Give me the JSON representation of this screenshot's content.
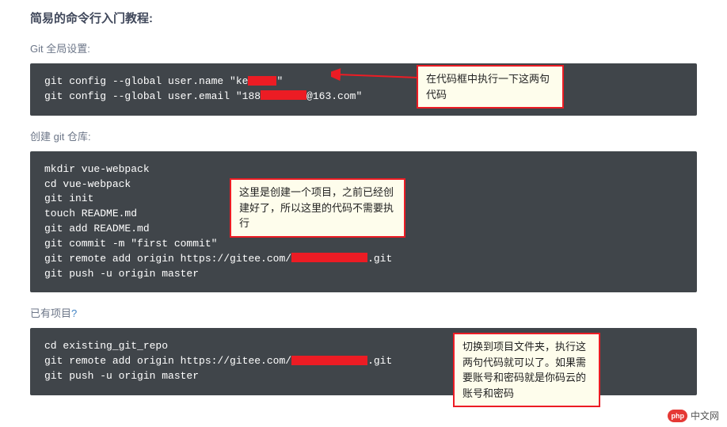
{
  "title": "简易的命令行入门教程:",
  "section1": {
    "label": "Git 全局设置:",
    "line1_a": "git config --global user.name \"ke",
    "line1_b": "\"",
    "line2_a": "git config --global user.email \"188",
    "line2_b": "@163.com\""
  },
  "section2": {
    "label": "创建 git 仓库:",
    "l1": "mkdir vue-webpack",
    "l2": "cd vue-webpack",
    "l3": "git init",
    "l4": "touch README.md",
    "l5": "git add README.md",
    "l6": "git commit -m \"first commit\"",
    "l7a": "git remote add origin https://gitee.com/",
    "l7b": ".git",
    "l8": "git push -u origin master"
  },
  "section3": {
    "label_a": "已有项目",
    "label_b": "?",
    "l1": "cd existing_git_repo",
    "l2a": "git remote add origin https://gitee.com/",
    "l2b": ".git",
    "l3": "git push -u origin master"
  },
  "callouts": {
    "c1": "在代码框中执行一下这两句代码",
    "c2": "这里是创建一个项目，之前已经创建好了，所以这里的代码不需要执行",
    "c3": "切换到项目文件夹，执行这两句代码就可以了。如果需要账号和密码就是你码云的账号和密码"
  },
  "watermark": {
    "logo": "php",
    "text": "中文网"
  }
}
